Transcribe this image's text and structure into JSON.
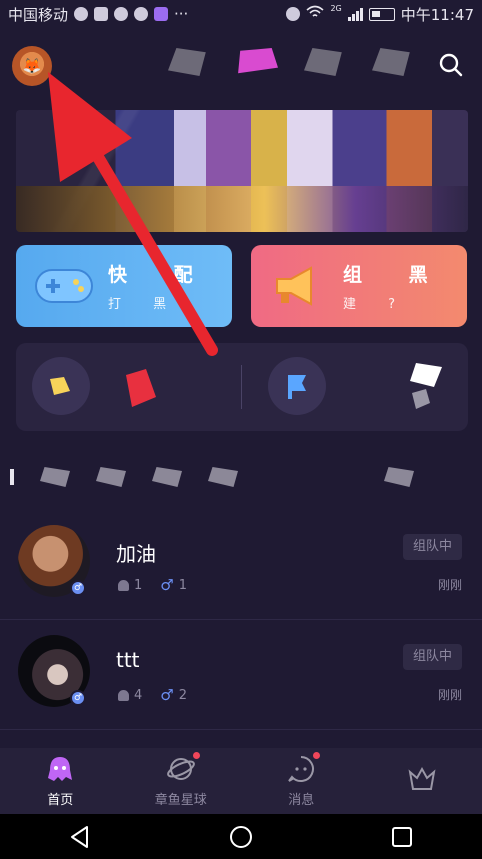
{
  "status_bar": {
    "carrier": "中国移动",
    "network": "2G",
    "time": "中午11:47"
  },
  "header": {
    "tabs": [
      "",
      "",
      "",
      "",
      ""
    ],
    "active_tab_index": 2
  },
  "cards": {
    "match": {
      "title": "快 配",
      "subtitle": "打 黑"
    },
    "team": {
      "title": "组 黑",
      "subtitle": "建 ?"
    }
  },
  "list": {
    "rows": [
      {
        "name": "加油",
        "members": "1",
        "males": "1",
        "status": "组队中",
        "time": "刚刚"
      },
      {
        "name": "ttt",
        "members": "4",
        "males": "2",
        "status": "组队中",
        "time": "刚刚"
      }
    ]
  },
  "bottom_nav": {
    "items": [
      {
        "label": "首页",
        "icon": "octopus-icon",
        "active": true
      },
      {
        "label": "章鱼星球",
        "icon": "planet-icon",
        "badge": true
      },
      {
        "label": "消息",
        "icon": "chat-icon",
        "badge": true
      },
      {
        "label": "",
        "icon": "crown-icon"
      }
    ]
  },
  "colors": {
    "background": "#1f1a33",
    "match_card": "#56a9ef",
    "team_card": "#f06a84",
    "accent_pink": "#d94bd0",
    "annotation_arrow": "#e8262e"
  }
}
